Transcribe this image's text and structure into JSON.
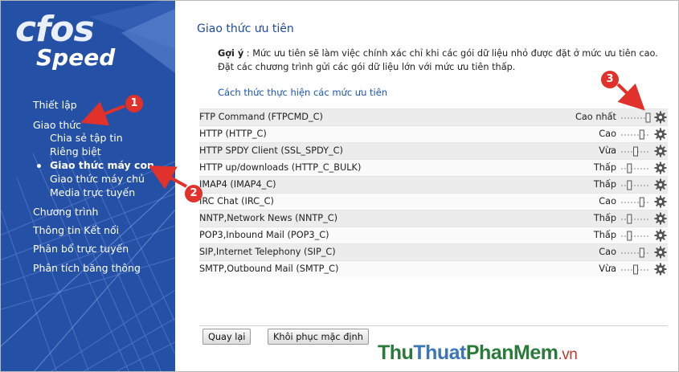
{
  "brand": {
    "line1": "cfos",
    "line2": "Speed"
  },
  "sidebar": {
    "items": [
      {
        "label": "Thiết lập"
      },
      {
        "label": "Giao thức"
      },
      {
        "label": "Chương trình"
      },
      {
        "label": "Thông tin Kết nối"
      },
      {
        "label": "Phân bổ trực tuyến"
      },
      {
        "label": "Phân tích băng thông"
      }
    ],
    "subitems": [
      {
        "label": "Chia sẻ tập tin"
      },
      {
        "label": "Riêng biệt"
      },
      {
        "label": "Giao thức máy con",
        "active": true
      },
      {
        "label": "Giao thức máy chủ"
      },
      {
        "label": "Media trực tuyến"
      }
    ]
  },
  "main": {
    "title": "Giao thức ưu tiên",
    "hint_label": "Gợi ý",
    "hint_text": " : Mức ưu tiên sẽ làm việc chính xác chỉ khi các gói dữ liệu nhỏ được đặt ở mức ưu tiên cao. Đặt các chương trình gửi các gói dữ liệu lớn với mức ưu tiên thấp.",
    "levels_link": "Cách thức thực hiện các mức ưu tiên",
    "protocols": [
      {
        "name": "FTP Command (FTPCMD_C)",
        "level": "Cao nhất",
        "slider_fraction": 1.0
      },
      {
        "name": "HTTP (HTTP_C)",
        "level": "Cao",
        "slider_fraction": 0.75
      },
      {
        "name": "HTTP SPDY Client (SSL_SPDY_C)",
        "level": "Vừa",
        "slider_fraction": 0.5
      },
      {
        "name": "HTTP up/downloads (HTTP_C_BULK)",
        "level": "Thấp",
        "slider_fraction": 0.25
      },
      {
        "name": "IMAP4 (IMAP4_C)",
        "level": "Thấp",
        "slider_fraction": 0.25
      },
      {
        "name": "IRC Chat (IRC_C)",
        "level": "Cao",
        "slider_fraction": 0.75
      },
      {
        "name": "NNTP,Network News (NNTP_C)",
        "level": "Thấp",
        "slider_fraction": 0.25
      },
      {
        "name": "POP3,Inbound Mail (POP3_C)",
        "level": "Thấp",
        "slider_fraction": 0.25
      },
      {
        "name": "SIP,Internet Telephony (SIP_C)",
        "level": "Cao",
        "slider_fraction": 0.75
      },
      {
        "name": "SMTP,Outbound Mail (SMTP_C)",
        "level": "Vừa",
        "slider_fraction": 0.5
      }
    ],
    "buttons": {
      "back": "Quay lại",
      "reset": "Khôi phục mặc định"
    }
  },
  "annotations": {
    "markers": [
      "1",
      "2",
      "3"
    ],
    "color": "#e0312b"
  },
  "watermark": {
    "part1": "Thu",
    "part2": "Thuat",
    "part3": "PhanMem",
    "part4": ".vn"
  },
  "colors": {
    "sidebar": "#2450a6",
    "title": "#1d4a9e",
    "link": "#1a55b5"
  },
  "icons": {
    "row_settings": "gear-icon"
  }
}
